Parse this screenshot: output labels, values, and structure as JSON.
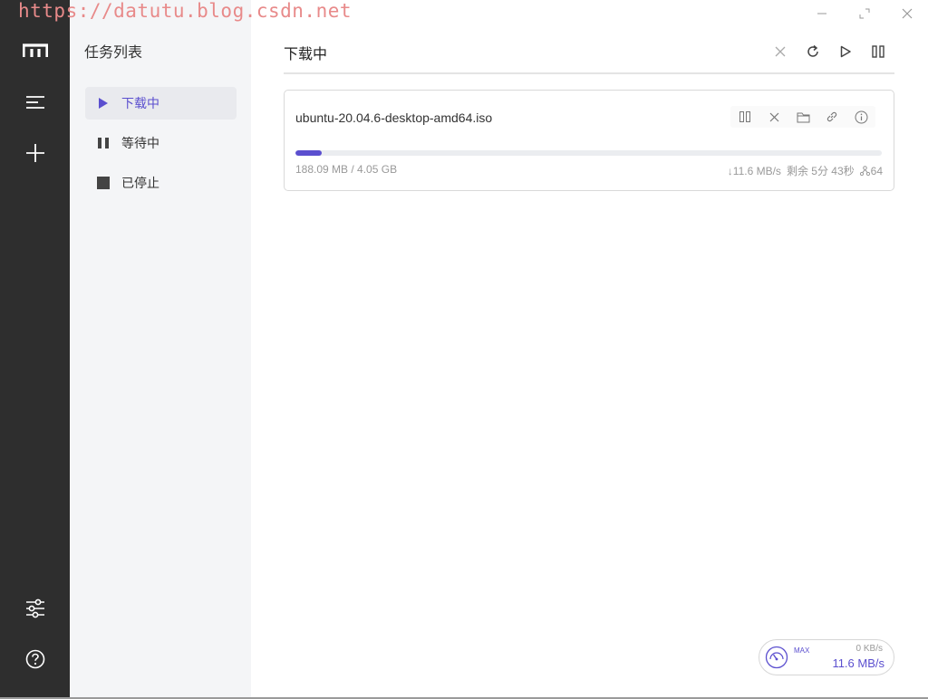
{
  "watermark": "https://datutu.blog.csdn.net",
  "window": {
    "controls": [
      "minimize",
      "maximize",
      "close"
    ]
  },
  "rail": {
    "items": [
      {
        "name": "logo-icon"
      },
      {
        "name": "task-list-icon"
      },
      {
        "name": "add-task-icon"
      },
      {
        "name": "preferences-icon"
      },
      {
        "name": "help-icon"
      }
    ]
  },
  "subnav": {
    "title": "任务列表",
    "items": [
      {
        "label": "下载中",
        "icon": "play-icon",
        "active": true
      },
      {
        "label": "等待中",
        "icon": "pause-icon",
        "active": false
      },
      {
        "label": "已停止",
        "icon": "stop-icon",
        "active": false
      }
    ]
  },
  "main": {
    "title": "下载中",
    "actions": [
      "delete-all",
      "refresh",
      "resume-all",
      "pause-all"
    ]
  },
  "task": {
    "name": "ubuntu-20.04.6-desktop-amd64.iso",
    "progress_fraction": 0.045,
    "size": "188.09 MB / 4.05 GB",
    "speed": "↓11.6 MB/s",
    "remaining": "剩余 5分 43秒",
    "connections": "64",
    "actions": [
      "pause",
      "delete",
      "folder",
      "link",
      "info"
    ]
  },
  "speedometer": {
    "max_label": "MAX",
    "upload": "0 KB/s",
    "download": "11.6 MB/s"
  },
  "colors": {
    "accent": "#5b4fcf",
    "rail_bg": "#2e2e2e",
    "subnav_bg": "#f4f5f7"
  }
}
